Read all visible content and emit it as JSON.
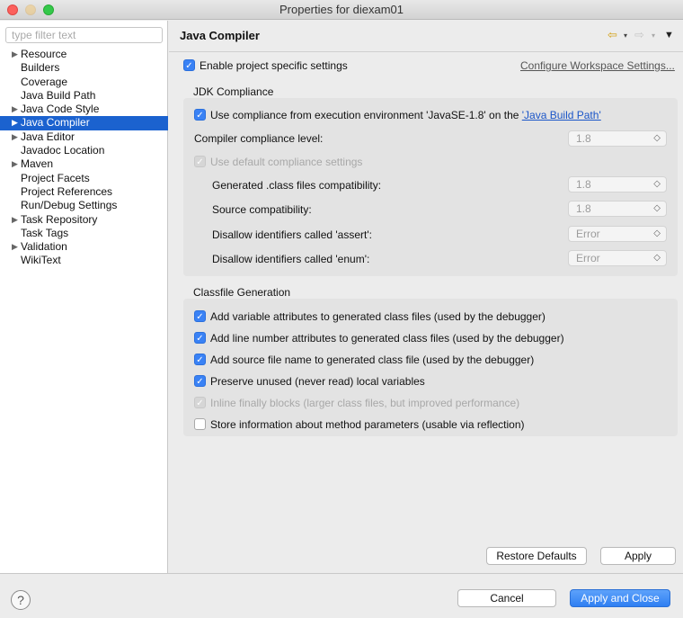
{
  "window": {
    "title": "Properties for diexam01"
  },
  "sidebar": {
    "filter_placeholder": "type filter text",
    "items": [
      {
        "label": "Resource",
        "expandable": true
      },
      {
        "label": "Builders",
        "expandable": false
      },
      {
        "label": "Coverage",
        "expandable": false
      },
      {
        "label": "Java Build Path",
        "expandable": false
      },
      {
        "label": "Java Code Style",
        "expandable": true
      },
      {
        "label": "Java Compiler",
        "expandable": true,
        "selected": true
      },
      {
        "label": "Java Editor",
        "expandable": true
      },
      {
        "label": "Javadoc Location",
        "expandable": false
      },
      {
        "label": "Maven",
        "expandable": true
      },
      {
        "label": "Project Facets",
        "expandable": false
      },
      {
        "label": "Project References",
        "expandable": false
      },
      {
        "label": "Run/Debug Settings",
        "expandable": false
      },
      {
        "label": "Task Repository",
        "expandable": true
      },
      {
        "label": "Task Tags",
        "expandable": false
      },
      {
        "label": "Validation",
        "expandable": true
      },
      {
        "label": "WikiText",
        "expandable": false
      }
    ]
  },
  "page": {
    "title": "Java Compiler",
    "enable_specific": "Enable project specific settings",
    "configure_link": "Configure Workspace Settings...",
    "jdk": {
      "heading": "JDK Compliance",
      "use_compliance_prefix": "Use compliance from execution environment 'JavaSE-1.8' on the ",
      "use_compliance_link": "'Java Build Path'",
      "compliance_level_label": "Compiler compliance level:",
      "compliance_level_value": "1.8",
      "use_default": "Use default compliance settings",
      "generated_label": "Generated .class files compatibility:",
      "generated_value": "1.8",
      "source_label": "Source compatibility:",
      "source_value": "1.8",
      "assert_label": "Disallow identifiers called 'assert':",
      "assert_value": "Error",
      "enum_label": "Disallow identifiers called 'enum':",
      "enum_value": "Error"
    },
    "classfile": {
      "heading": "Classfile Generation",
      "options": [
        {
          "label": "Add variable attributes to generated class files (used by the debugger)",
          "state": "on"
        },
        {
          "label": "Add line number attributes to generated class files (used by the debugger)",
          "state": "on"
        },
        {
          "label": "Add source file name to generated class file (used by the debugger)",
          "state": "on"
        },
        {
          "label": "Preserve unused (never read) local variables",
          "state": "on"
        },
        {
          "label": "Inline finally blocks (larger class files, but improved performance)",
          "state": "disabled"
        },
        {
          "label": "Store information about method parameters (usable via reflection)",
          "state": "off"
        }
      ]
    },
    "restore_defaults": "Restore Defaults",
    "apply": "Apply"
  },
  "footer": {
    "help": "?",
    "cancel": "Cancel",
    "apply_close": "Apply and Close"
  },
  "icons": {
    "check": "checkmark-icon",
    "chevron": "updown-chevron-icon",
    "expand": "triangle-right-icon"
  }
}
